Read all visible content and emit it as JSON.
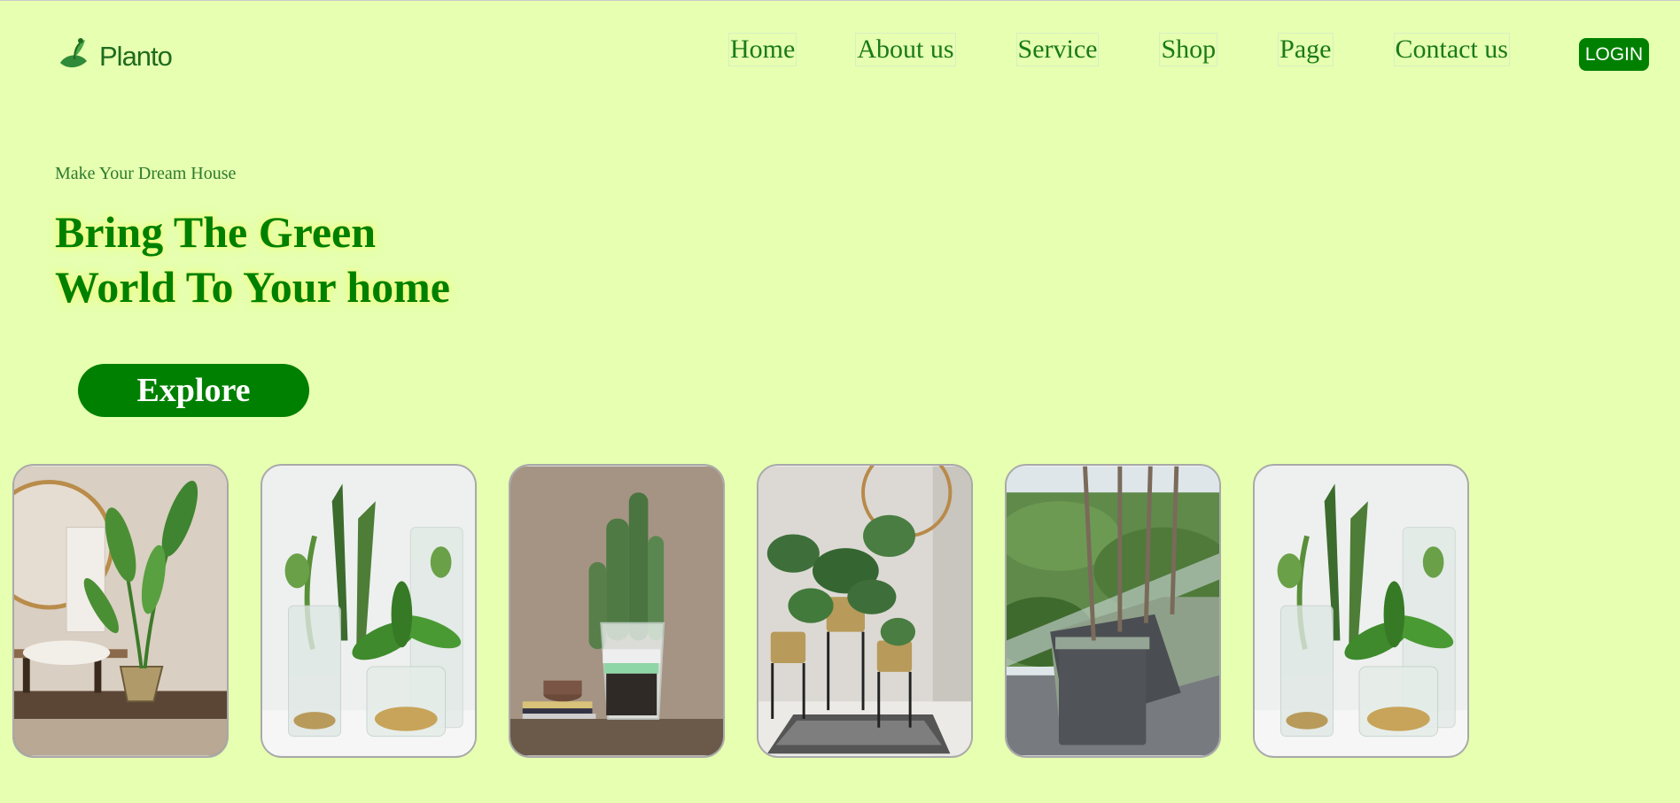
{
  "brand": {
    "name": "Planto"
  },
  "nav": {
    "items": [
      {
        "label": "Home"
      },
      {
        "label": "About us"
      },
      {
        "label": "Service"
      },
      {
        "label": "Shop"
      },
      {
        "label": "Page"
      },
      {
        "label": "Contact us"
      }
    ],
    "login_label": "LOGIN"
  },
  "hero": {
    "subtitle": "Make Your Dream House",
    "headline_line1": "Bring The Green",
    "headline_line2": "World To Your home",
    "cta_label": "Explore"
  },
  "gallery": {
    "photos": [
      {
        "icon": "bird-of-paradise-plant-photo"
      },
      {
        "icon": "snake-plant-glass-vases-photo"
      },
      {
        "icon": "cactus-glass-pot-photo"
      },
      {
        "icon": "monstera-brass-planters-photo"
      },
      {
        "icon": "balcony-trees-planters-photo"
      },
      {
        "icon": "snake-plant-glass-vases-photo"
      }
    ]
  },
  "colors": {
    "background": "#e6ffb0",
    "accent": "#008000",
    "nav_text": "#1a7a1a"
  }
}
